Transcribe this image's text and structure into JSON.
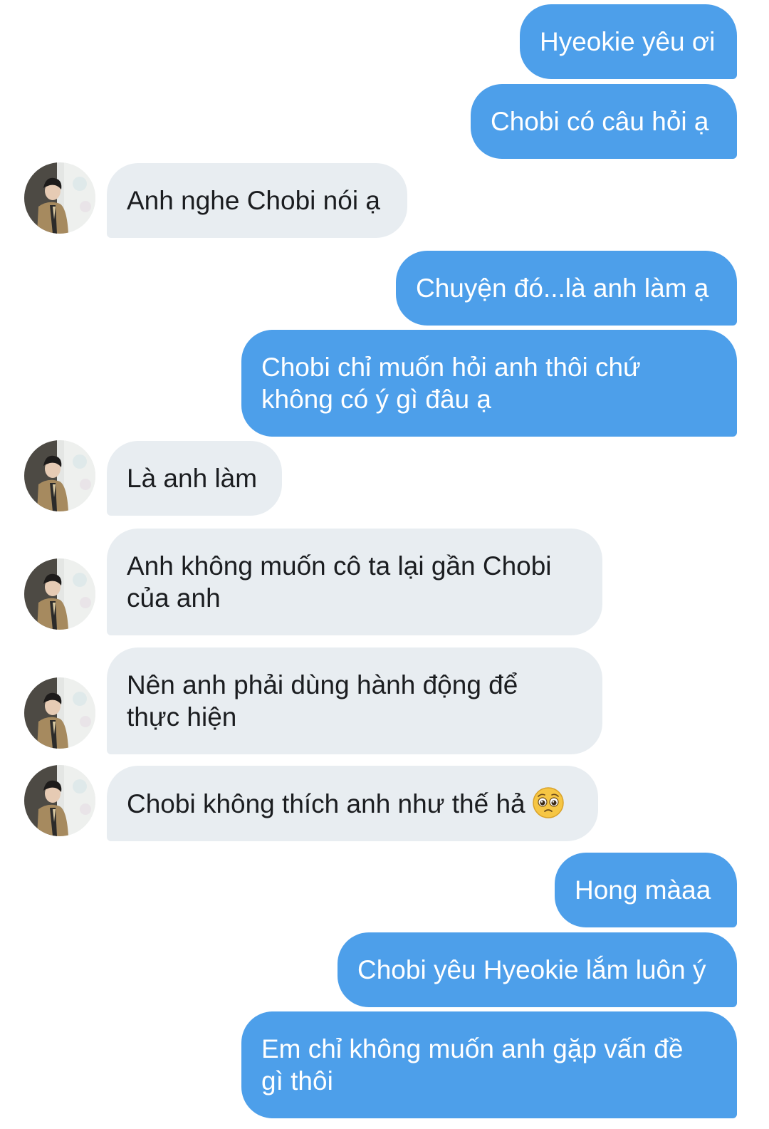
{
  "conversation": {
    "messages": [
      {
        "side": "sent",
        "text": "Hyeokie yêu ơi"
      },
      {
        "side": "sent",
        "text": "Chobi có câu hỏi ạ"
      },
      {
        "side": "received",
        "text": "Anh nghe Chobi nói ạ"
      },
      {
        "side": "sent",
        "text": "Chuyện đó...là anh làm ạ"
      },
      {
        "side": "sent",
        "text": "Chobi chỉ muốn hỏi anh thôi chứ không có ý gì đâu ạ"
      },
      {
        "side": "received",
        "text": "Là anh làm"
      },
      {
        "side": "received",
        "text": "Anh không muốn cô ta lại gần Chobi của anh"
      },
      {
        "side": "received",
        "text": "Nên anh phải dùng hành động để thực hiện"
      },
      {
        "side": "received",
        "text": "Chobi không thích anh như thế hả",
        "emoji": "pleading-face-icon"
      },
      {
        "side": "sent",
        "text": "Hong màaa"
      },
      {
        "side": "sent",
        "text": "Chobi yêu Hyeokie lắm luôn ý"
      },
      {
        "side": "sent",
        "text": "Em chỉ không muốn anh gặp vấn đề gì thôi"
      }
    ]
  },
  "colors": {
    "sent_bubble": "#4d9fea",
    "received_bubble": "#e8edf1",
    "background": "#ffffff"
  }
}
